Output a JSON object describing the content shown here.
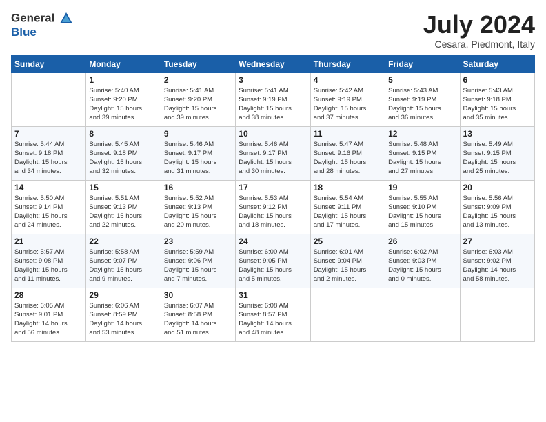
{
  "header": {
    "logo_line1": "General",
    "logo_line2": "Blue",
    "title": "July 2024",
    "subtitle": "Cesara, Piedmont, Italy"
  },
  "columns": [
    "Sunday",
    "Monday",
    "Tuesday",
    "Wednesday",
    "Thursday",
    "Friday",
    "Saturday"
  ],
  "weeks": [
    [
      {
        "day": "",
        "info": ""
      },
      {
        "day": "1",
        "info": "Sunrise: 5:40 AM\nSunset: 9:20 PM\nDaylight: 15 hours\nand 39 minutes."
      },
      {
        "day": "2",
        "info": "Sunrise: 5:41 AM\nSunset: 9:20 PM\nDaylight: 15 hours\nand 39 minutes."
      },
      {
        "day": "3",
        "info": "Sunrise: 5:41 AM\nSunset: 9:19 PM\nDaylight: 15 hours\nand 38 minutes."
      },
      {
        "day": "4",
        "info": "Sunrise: 5:42 AM\nSunset: 9:19 PM\nDaylight: 15 hours\nand 37 minutes."
      },
      {
        "day": "5",
        "info": "Sunrise: 5:43 AM\nSunset: 9:19 PM\nDaylight: 15 hours\nand 36 minutes."
      },
      {
        "day": "6",
        "info": "Sunrise: 5:43 AM\nSunset: 9:18 PM\nDaylight: 15 hours\nand 35 minutes."
      }
    ],
    [
      {
        "day": "7",
        "info": "Sunrise: 5:44 AM\nSunset: 9:18 PM\nDaylight: 15 hours\nand 34 minutes."
      },
      {
        "day": "8",
        "info": "Sunrise: 5:45 AM\nSunset: 9:18 PM\nDaylight: 15 hours\nand 32 minutes."
      },
      {
        "day": "9",
        "info": "Sunrise: 5:46 AM\nSunset: 9:17 PM\nDaylight: 15 hours\nand 31 minutes."
      },
      {
        "day": "10",
        "info": "Sunrise: 5:46 AM\nSunset: 9:17 PM\nDaylight: 15 hours\nand 30 minutes."
      },
      {
        "day": "11",
        "info": "Sunrise: 5:47 AM\nSunset: 9:16 PM\nDaylight: 15 hours\nand 28 minutes."
      },
      {
        "day": "12",
        "info": "Sunrise: 5:48 AM\nSunset: 9:15 PM\nDaylight: 15 hours\nand 27 minutes."
      },
      {
        "day": "13",
        "info": "Sunrise: 5:49 AM\nSunset: 9:15 PM\nDaylight: 15 hours\nand 25 minutes."
      }
    ],
    [
      {
        "day": "14",
        "info": "Sunrise: 5:50 AM\nSunset: 9:14 PM\nDaylight: 15 hours\nand 24 minutes."
      },
      {
        "day": "15",
        "info": "Sunrise: 5:51 AM\nSunset: 9:13 PM\nDaylight: 15 hours\nand 22 minutes."
      },
      {
        "day": "16",
        "info": "Sunrise: 5:52 AM\nSunset: 9:13 PM\nDaylight: 15 hours\nand 20 minutes."
      },
      {
        "day": "17",
        "info": "Sunrise: 5:53 AM\nSunset: 9:12 PM\nDaylight: 15 hours\nand 18 minutes."
      },
      {
        "day": "18",
        "info": "Sunrise: 5:54 AM\nSunset: 9:11 PM\nDaylight: 15 hours\nand 17 minutes."
      },
      {
        "day": "19",
        "info": "Sunrise: 5:55 AM\nSunset: 9:10 PM\nDaylight: 15 hours\nand 15 minutes."
      },
      {
        "day": "20",
        "info": "Sunrise: 5:56 AM\nSunset: 9:09 PM\nDaylight: 15 hours\nand 13 minutes."
      }
    ],
    [
      {
        "day": "21",
        "info": "Sunrise: 5:57 AM\nSunset: 9:08 PM\nDaylight: 15 hours\nand 11 minutes."
      },
      {
        "day": "22",
        "info": "Sunrise: 5:58 AM\nSunset: 9:07 PM\nDaylight: 15 hours\nand 9 minutes."
      },
      {
        "day": "23",
        "info": "Sunrise: 5:59 AM\nSunset: 9:06 PM\nDaylight: 15 hours\nand 7 minutes."
      },
      {
        "day": "24",
        "info": "Sunrise: 6:00 AM\nSunset: 9:05 PM\nDaylight: 15 hours\nand 5 minutes."
      },
      {
        "day": "25",
        "info": "Sunrise: 6:01 AM\nSunset: 9:04 PM\nDaylight: 15 hours\nand 2 minutes."
      },
      {
        "day": "26",
        "info": "Sunrise: 6:02 AM\nSunset: 9:03 PM\nDaylight: 15 hours\nand 0 minutes."
      },
      {
        "day": "27",
        "info": "Sunrise: 6:03 AM\nSunset: 9:02 PM\nDaylight: 14 hours\nand 58 minutes."
      }
    ],
    [
      {
        "day": "28",
        "info": "Sunrise: 6:05 AM\nSunset: 9:01 PM\nDaylight: 14 hours\nand 56 minutes."
      },
      {
        "day": "29",
        "info": "Sunrise: 6:06 AM\nSunset: 8:59 PM\nDaylight: 14 hours\nand 53 minutes."
      },
      {
        "day": "30",
        "info": "Sunrise: 6:07 AM\nSunset: 8:58 PM\nDaylight: 14 hours\nand 51 minutes."
      },
      {
        "day": "31",
        "info": "Sunrise: 6:08 AM\nSunset: 8:57 PM\nDaylight: 14 hours\nand 48 minutes."
      },
      {
        "day": "",
        "info": ""
      },
      {
        "day": "",
        "info": ""
      },
      {
        "day": "",
        "info": ""
      }
    ]
  ]
}
